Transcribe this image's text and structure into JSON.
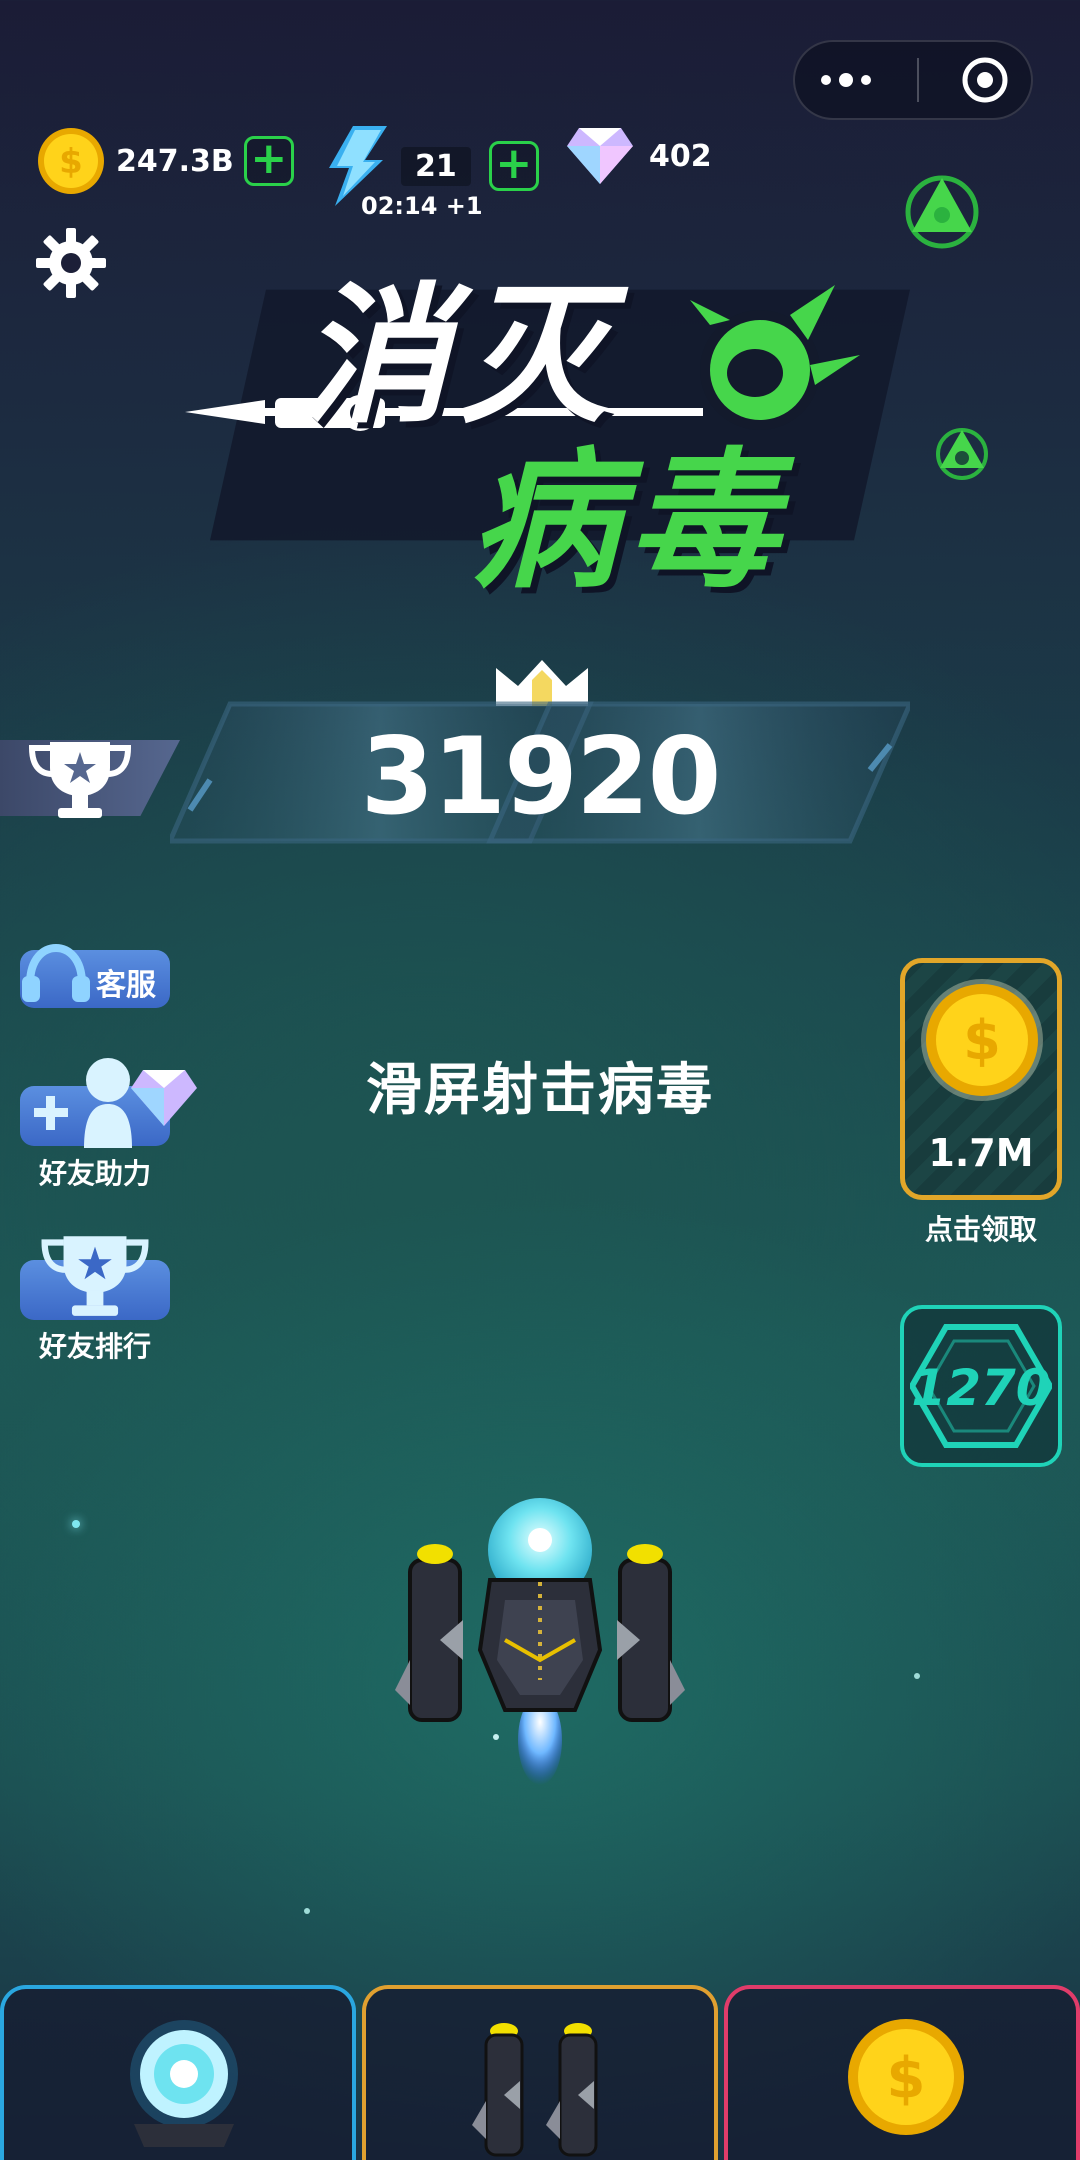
{
  "window_controls": {
    "more_icon": "more-dots-icon",
    "close_icon": "target-circle-icon"
  },
  "currencies": {
    "coins": {
      "value": "247.3B",
      "icon": "gold-coin-icon"
    },
    "energy": {
      "value": "21",
      "timer": "02:14 +1",
      "icon": "lightning-icon"
    },
    "diamonds": {
      "value": "402",
      "icon": "diamond-icon"
    }
  },
  "game_title": {
    "line1": "消灭",
    "line2": "病毒"
  },
  "score": {
    "value": "31920"
  },
  "side_menu": {
    "customer_service": "客服",
    "friend_help": "好友助力",
    "friend_rank": "好友排行"
  },
  "hint": "滑屏射击病毒",
  "reward": {
    "amount": "1.7M",
    "label": "点击领取"
  },
  "level_badge": {
    "value": "1270"
  },
  "bottom_tabs": [
    {
      "name": "tab-upgrade-core",
      "icon": "energy-orb-icon"
    },
    {
      "name": "tab-upgrade-wings",
      "icon": "side-cannons-icon"
    },
    {
      "name": "tab-upgrade-coins",
      "icon": "gold-coin-icon"
    }
  ],
  "colors": {
    "green_accent": "#46d64b",
    "gold": "#f2c400",
    "cyan": "#1fd3b8",
    "tab_blue": "#2aa7e0",
    "tab_orange": "#e0a030",
    "tab_red": "#e03c6a"
  }
}
